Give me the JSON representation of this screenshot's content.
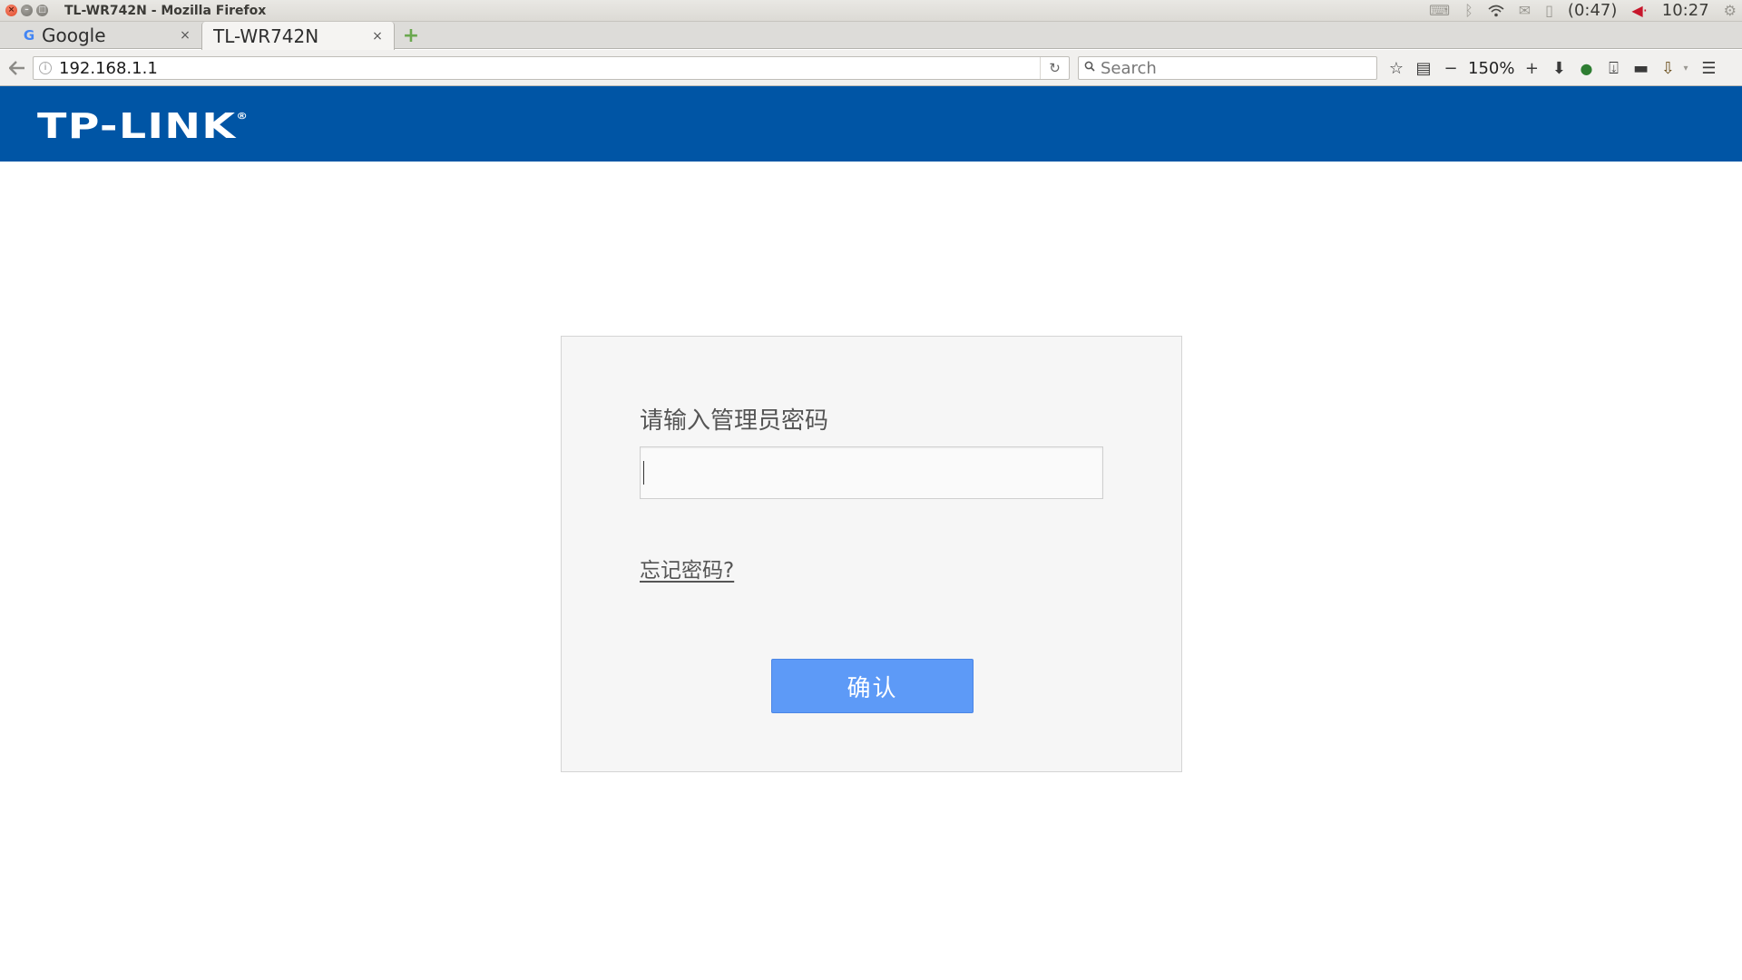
{
  "os_panel": {
    "window_title": "TL-WR742N - Mozilla Firefox",
    "battery_time": "(0:47)",
    "clock": "10:27"
  },
  "tabs": [
    {
      "label": "Google",
      "favicon": "G"
    },
    {
      "label": "TL-WR742N"
    }
  ],
  "tab_close_glyph": "×",
  "new_tab_glyph": "+",
  "nav": {
    "url": "192.168.1.1",
    "search_placeholder": "Search",
    "zoom_level": "150%",
    "zoom_minus": "−",
    "zoom_plus": "+"
  },
  "page": {
    "brand": "TP-LINK",
    "brand_mark": "®",
    "login": {
      "prompt": "请输入管理员密码",
      "password_value": "",
      "forgot_link": "忘记密码?",
      "confirm_button": "确认"
    }
  },
  "colors": {
    "brand_blue": "#0055a5",
    "button_blue": "#5d9af7",
    "panel_bg": "#f6f6f6"
  },
  "icons": {
    "back": "back-arrow-icon",
    "info": "info-icon",
    "reload": "reload-icon",
    "search": "search-icon",
    "bookmark": "star-icon",
    "reader": "clipboard-icon",
    "download": "download-arrow-icon",
    "addon": "shield-icon",
    "save": "save-icon",
    "screen": "screen-icon",
    "menu": "hamburger-menu-icon"
  }
}
